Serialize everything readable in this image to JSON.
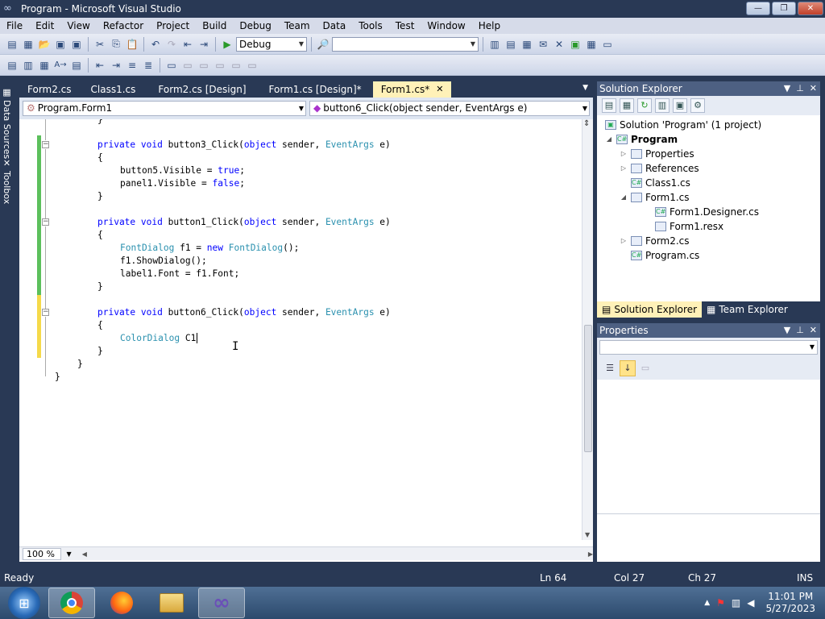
{
  "window": {
    "title": "Program - Microsoft Visual Studio",
    "min": "—",
    "max": "❐",
    "close": "✕"
  },
  "menu": [
    "File",
    "Edit",
    "View",
    "Refactor",
    "Project",
    "Build",
    "Debug",
    "Team",
    "Data",
    "Tools",
    "Test",
    "Window",
    "Help"
  ],
  "toolbar": {
    "config": "Debug",
    "platform": ""
  },
  "side_tabs": {
    "data_sources": "Data Sources",
    "toolbox": "Toolbox"
  },
  "tabs": [
    "Form2.cs",
    "Class1.cs",
    "Form2.cs [Design]",
    "Form1.cs [Design]*",
    "Form1.cs*"
  ],
  "active_tab": "Form1.cs*",
  "tab_close": "✕",
  "nav": {
    "type": "Program.Form1",
    "member": "button6_Click(object sender, EventArgs e)"
  },
  "code": {
    "l0": "}",
    "l1a": "private ",
    "l1b": "void",
    "l1c": " button3_Click(",
    "l1d": "object",
    "l1e": " sender, ",
    "l1f": "EventArgs",
    "l1g": " e)",
    "l2": "{",
    "l3a": "button5.Visible = ",
    "l3b": "true",
    "l3c": ";",
    "l4a": "panel1.Visible = ",
    "l4b": "false",
    "l4c": ";",
    "l5": "}",
    "l6a": "private ",
    "l6b": "void",
    "l6c": " button1_Click(",
    "l6d": "object",
    "l6e": " sender, ",
    "l6f": "EventArgs",
    "l6g": " e)",
    "l7": "{",
    "l8a": "FontDialog",
    "l8b": " f1 = ",
    "l8c": "new",
    "l8d": " ",
    "l8e": "FontDialog",
    "l8f": "();",
    "l9": "f1.ShowDialog();",
    "l10": "label1.Font = f1.Font;",
    "l11": "}",
    "l12a": "private ",
    "l12b": "void",
    "l12c": " button6_Click(",
    "l12d": "object",
    "l12e": " sender, ",
    "l12f": "EventArgs",
    "l12g": " e)",
    "l13": "{",
    "l14a": "ColorDialog",
    "l14b": " C1",
    "l15": "}",
    "l16": "}",
    "l17": "}"
  },
  "zoom": "100 %",
  "solution_explorer": {
    "title": "Solution Explorer",
    "solution": "Solution 'Program' (1 project)",
    "project": "Program",
    "items": {
      "properties": "Properties",
      "references": "References",
      "class1": "Class1.cs",
      "form1": "Form1.cs",
      "form1_designer": "Form1.Designer.cs",
      "form1_resx": "Form1.resx",
      "form2": "Form2.cs",
      "program": "Program.cs"
    }
  },
  "bottom_tabs": {
    "solution_explorer": "Solution Explorer",
    "team_explorer": "Team Explorer"
  },
  "properties": {
    "title": "Properties"
  },
  "status": {
    "ready": "Ready",
    "ln": "Ln 64",
    "col": "Col 27",
    "ch": "Ch 27",
    "ins": "INS"
  },
  "clock": {
    "time": "11:01 PM",
    "date": "5/27/2023"
  }
}
